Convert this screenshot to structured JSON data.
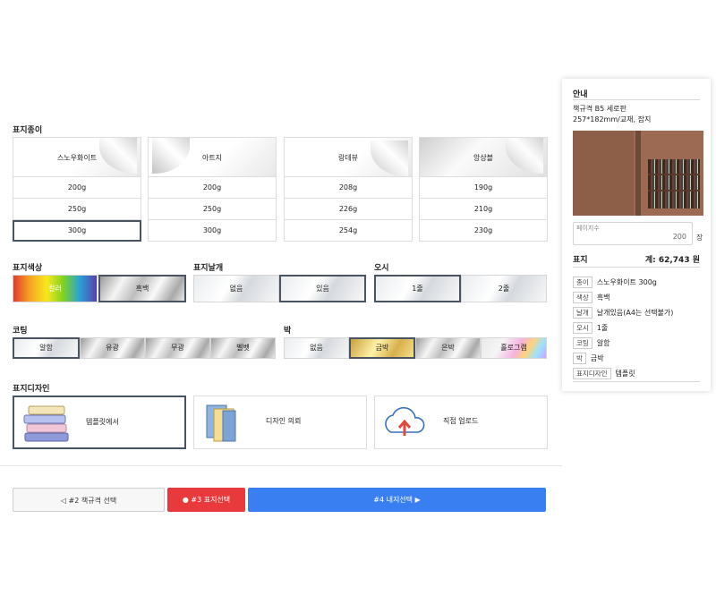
{
  "sections": {
    "paper": "표지종이",
    "color": "표지색상",
    "wing": "표지날개",
    "osi": "오시",
    "coating": "코팅",
    "foil": "박",
    "design": "표지디자인"
  },
  "papers": [
    {
      "name": "스노우화이트",
      "weights": [
        "200g",
        "250g",
        "300g"
      ]
    },
    {
      "name": "아트지",
      "weights": [
        "200g",
        "250g",
        "300g"
      ]
    },
    {
      "name": "랑데뷰",
      "weights": [
        "208g",
        "226g",
        "254g"
      ]
    },
    {
      "name": "앙상블",
      "weights": [
        "190g",
        "210g",
        "230g"
      ]
    }
  ],
  "color_opts": [
    "컬러",
    "흑백"
  ],
  "wing_opts": [
    "없음",
    "있음"
  ],
  "osi_opts": [
    "1줄",
    "2줄"
  ],
  "coating_opts": [
    "알함",
    "유광",
    "무광",
    "벨벳"
  ],
  "foil_opts": [
    "없음",
    "금박",
    "은박",
    "홀로그램"
  ],
  "design_opts": [
    "템플릿에서",
    "디자인 의뢰",
    "직접 업로드"
  ],
  "buttons": {
    "prev": "◁ #2 책규격 선택",
    "current": "● #3 표지선택",
    "next": "#4 내지선택 ▶"
  },
  "sidebar": {
    "title": "안내",
    "spec_line1": "책규격 B5 세로판",
    "spec_line2": "257*182mm/교재, 잡지",
    "pages_label": "페이지수",
    "pages_value": "200",
    "pages_unit": "장",
    "section": "표지",
    "total": "계: 62,743 원",
    "summary": [
      {
        "tag": "종이",
        "value": "스노우화이트 300g"
      },
      {
        "tag": "색상",
        "value": "흑백"
      },
      {
        "tag": "날개",
        "value": "날개있음(A4는 선택불가)"
      },
      {
        "tag": "오시",
        "value": "1줄"
      },
      {
        "tag": "코팅",
        "value": "알함"
      },
      {
        "tag": "박",
        "value": "금박"
      },
      {
        "tag": "표지디자인",
        "value": "템플릿"
      }
    ]
  },
  "colors": {
    "selected_border": "#4a5362",
    "current_button": "#e8393d",
    "next_button": "#3a7ff1"
  }
}
